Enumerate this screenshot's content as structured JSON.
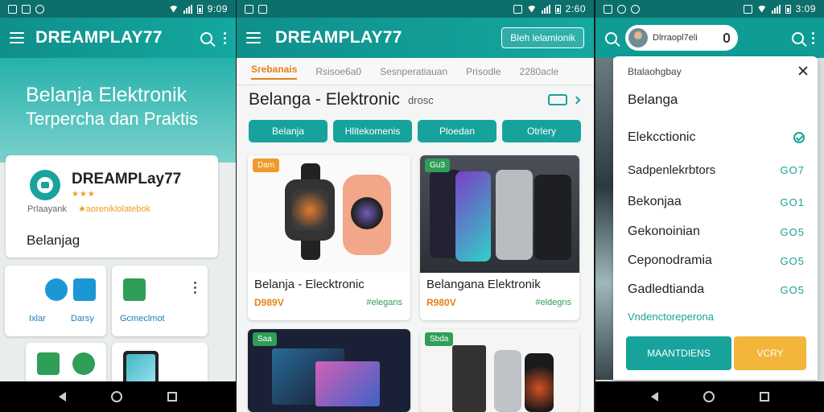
{
  "status": {
    "time_1": "9:09",
    "time_2": "2:60",
    "time_3": "3:09"
  },
  "panel1": {
    "app_title": "DREAMPLAY77",
    "hero_line1": "Belanja Elektronik",
    "hero_line2": "Terpercha dan Praktis",
    "card": {
      "name": "DREAMPLay77",
      "stars": "★★★",
      "sub_left": "Prlaayank",
      "sub_right": "★aoreniklolatebok",
      "category": "Belanjag"
    },
    "tiles": [
      {
        "label": "Ixlar"
      },
      {
        "label": "Darsy"
      },
      {
        "label": "Gcmeclmot"
      }
    ]
  },
  "panel2": {
    "app_title": "DREAMPLAY77",
    "action_button": "Bleh lelamionik",
    "tabs": [
      "Srebanais",
      "Rsisoe6a0",
      "Sesnperatiauan",
      "Prisodle",
      "2280acle"
    ],
    "section_title": "Belanga - Elektronic",
    "section_sub": "drosc",
    "pills": [
      "Belanja",
      "Hlitekomenis",
      "Ploedan",
      "Otrlery"
    ],
    "products": [
      {
        "badge": "Dam",
        "badge_color": "#f19a2a",
        "name": "Belanja - Elecktronic",
        "price": "D989V",
        "tag": "#elegans"
      },
      {
        "badge": "Gu3",
        "badge_color": "#2f9e57",
        "name": "Belangana  Elektronik",
        "price": "R980V",
        "tag": "#eldegns"
      },
      {
        "badge": "Saa",
        "badge_color": "#2f9e57"
      },
      {
        "badge": "Sbda",
        "badge_color": "#2f9e57"
      }
    ]
  },
  "panel3": {
    "user_name": "Dlrraopl7eli",
    "sheet_header": "Btalaohgbay",
    "sheet_title": "Belanga",
    "menu": [
      {
        "label": "Elekcctionic",
        "value": ""
      },
      {
        "label": "Sadpenlekrbtors",
        "value": "GO7"
      },
      {
        "label": "Bekonjaa",
        "value": "GO1"
      },
      {
        "label": "Gekonoinian",
        "value": "GO5"
      },
      {
        "label": "Ceponodramia",
        "value": "GO5"
      },
      {
        "label": "Gadledtianda",
        "value": "GO5"
      }
    ],
    "link": "Vndenctoreperona",
    "btn_primary": "MAANTDIENS",
    "btn_secondary": "VCRY"
  },
  "colors": {
    "primary": "#17a39c",
    "accent": "#e3811b",
    "secondary_button": "#f3b63b"
  }
}
